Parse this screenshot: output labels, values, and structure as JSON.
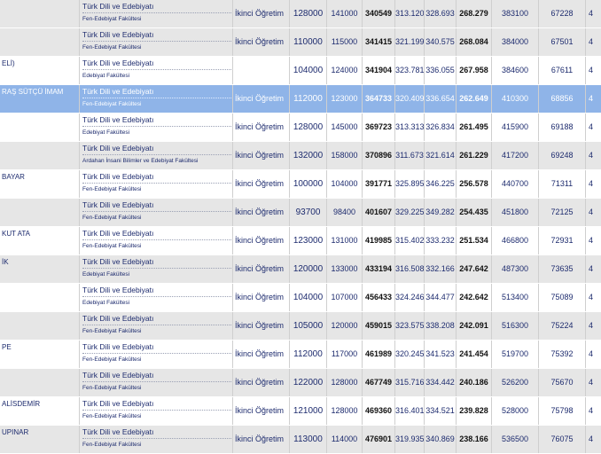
{
  "rows": [
    {
      "uni": "",
      "program": "Türk Dili ve Edebiyatı",
      "faculty": "Fen-Edebiyat Fakültesi",
      "type": "İkinci Öğretim",
      "n1": "128000",
      "n2": "141000",
      "n3": "340549",
      "n4": "313.120",
      "n5": "328.693",
      "n6": "268.279",
      "n7": "383100",
      "n8": "67228",
      "n9": "4"
    },
    {
      "uni": "",
      "program": "Türk Dili ve Edebiyatı",
      "faculty": "Fen-Edebiyat Fakültesi",
      "type": "İkinci Öğretim",
      "n1": "110000",
      "n2": "115000",
      "n3": "341415",
      "n4": "321.199",
      "n5": "340.575",
      "n6": "268.084",
      "n7": "384000",
      "n8": "67501",
      "n9": "4"
    },
    {
      "uni": "ELİ)",
      "program": "Türk Dili ve Edebiyatı",
      "faculty": "Edebiyat Fakültesi",
      "type": "",
      "n1": "104000",
      "n2": "124000",
      "n3": "341904",
      "n4": "323.781",
      "n5": "336.055",
      "n6": "267.958",
      "n7": "384600",
      "n8": "67611",
      "n9": "4"
    },
    {
      "uni": "RAŞ SÜTÇÜ İMAM",
      "program": "Türk Dili ve Edebiyatı",
      "faculty": "Fen-Edebiyat Fakültesi",
      "type": "İkinci Öğretim",
      "n1": "112000",
      "n2": "123000",
      "n3": "364733",
      "n4": "320.409",
      "n5": "336.654",
      "n6": "262.649",
      "n7": "410300",
      "n8": "68856",
      "n9": "4"
    },
    {
      "uni": "",
      "program": "Türk Dili ve Edebiyatı",
      "faculty": "Edebiyat Fakültesi",
      "type": "İkinci Öğretim",
      "n1": "128000",
      "n2": "145000",
      "n3": "369723",
      "n4": "313.313",
      "n5": "326.834",
      "n6": "261.495",
      "n7": "415900",
      "n8": "69188",
      "n9": "4"
    },
    {
      "uni": "",
      "program": "Türk Dili ve Edebiyatı",
      "faculty": "Ardahan İnsani Bilimler ve Edebiyat Fakültesi",
      "type": "İkinci Öğretim",
      "n1": "132000",
      "n2": "158000",
      "n3": "370896",
      "n4": "311.673",
      "n5": "321.614",
      "n6": "261.229",
      "n7": "417200",
      "n8": "69248",
      "n9": "4"
    },
    {
      "uni": "BAYAR",
      "program": "Türk Dili ve Edebiyatı",
      "faculty": "Fen-Edebiyat Fakültesi",
      "type": "İkinci Öğretim",
      "n1": "100000",
      "n2": "104000",
      "n3": "391771",
      "n4": "325.895",
      "n5": "346.225",
      "n6": "256.578",
      "n7": "440700",
      "n8": "71311",
      "n9": "4"
    },
    {
      "uni": "",
      "program": "Türk Dili ve Edebiyatı",
      "faculty": "Fen-Edebiyat Fakültesi",
      "type": "İkinci Öğretim",
      "n1": "93700",
      "n2": "98400",
      "n3": "401607",
      "n4": "329.225",
      "n5": "349.282",
      "n6": "254.435",
      "n7": "451800",
      "n8": "72125",
      "n9": "4"
    },
    {
      "uni": "KUT ATA",
      "program": "Türk Dili ve Edebiyatı",
      "faculty": "Fen-Edebiyat Fakültesi",
      "type": "İkinci Öğretim",
      "n1": "123000",
      "n2": "131000",
      "n3": "419985",
      "n4": "315.402",
      "n5": "333.232",
      "n6": "251.534",
      "n7": "466800",
      "n8": "72931",
      "n9": "4"
    },
    {
      "uni": "İK",
      "program": "Türk Dili ve Edebiyatı",
      "faculty": "Edebiyat Fakültesi",
      "type": "İkinci Öğretim",
      "n1": "120000",
      "n2": "133000",
      "n3": "433194",
      "n4": "316.508",
      "n5": "332.166",
      "n6": "247.642",
      "n7": "487300",
      "n8": "73635",
      "n9": "4"
    },
    {
      "uni": "",
      "program": "Türk Dili ve Edebiyatı",
      "faculty": "Edebiyat Fakültesi",
      "type": "İkinci Öğretim",
      "n1": "104000",
      "n2": "107000",
      "n3": "456433",
      "n4": "324.246",
      "n5": "344.477",
      "n6": "242.642",
      "n7": "513400",
      "n8": "75089",
      "n9": "4"
    },
    {
      "uni": "",
      "program": "Türk Dili ve Edebiyatı",
      "faculty": "Fen-Edebiyat Fakültesi",
      "type": "İkinci Öğretim",
      "n1": "105000",
      "n2": "120000",
      "n3": "459015",
      "n4": "323.575",
      "n5": "338.208",
      "n6": "242.091",
      "n7": "516300",
      "n8": "75224",
      "n9": "4"
    },
    {
      "uni": "PE",
      "program": "Türk Dili ve Edebiyatı",
      "faculty": "Fen-Edebiyat Fakültesi",
      "type": "İkinci Öğretim",
      "n1": "112000",
      "n2": "117000",
      "n3": "461989",
      "n4": "320.245",
      "n5": "341.523",
      "n6": "241.454",
      "n7": "519700",
      "n8": "75392",
      "n9": "4"
    },
    {
      "uni": "",
      "program": "Türk Dili ve Edebiyatı",
      "faculty": "Fen-Edebiyat Fakültesi",
      "type": "İkinci Öğretim",
      "n1": "122000",
      "n2": "128000",
      "n3": "467749",
      "n4": "315.716",
      "n5": "334.442",
      "n6": "240.186",
      "n7": "526200",
      "n8": "75670",
      "n9": "4"
    },
    {
      "uni": "ALİSDEMİR",
      "program": "Türk Dili ve Edebiyatı",
      "faculty": "Fen-Edebiyat Fakültesi",
      "type": "İkinci Öğretim",
      "n1": "121000",
      "n2": "128000",
      "n3": "469360",
      "n4": "316.401",
      "n5": "334.521",
      "n6": "239.828",
      "n7": "528000",
      "n8": "75798",
      "n9": "4"
    },
    {
      "uni": "UPINAR",
      "program": "Türk Dili ve Edebiyatı",
      "faculty": "Fen-Edebiyat Fakültesi",
      "type": "İkinci Öğretim",
      "n1": "113000",
      "n2": "114000",
      "n3": "476901",
      "n4": "319.935",
      "n5": "340.869",
      "n6": "238.166",
      "n7": "536500",
      "n8": "76075",
      "n9": "4"
    }
  ]
}
